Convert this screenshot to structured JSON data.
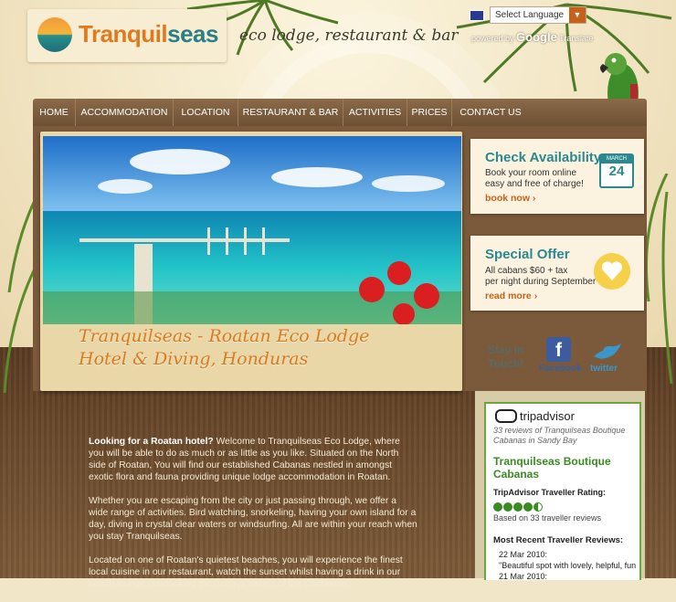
{
  "header": {
    "logo_text_a": "Tranquil",
    "logo_text_b": "seas",
    "tagline": "eco lodge, restaurant & bar"
  },
  "translate": {
    "select_label": "Select Language",
    "powered_by": "powered by",
    "google": "Google",
    "translate": "Translate"
  },
  "nav": {
    "items": [
      {
        "label": "HOME"
      },
      {
        "label": "ACCOMMODATION"
      },
      {
        "label": "LOCATION"
      },
      {
        "label": "RESTAURANT & BAR"
      },
      {
        "label": "ACTIVITIES"
      },
      {
        "label": "PRICES"
      },
      {
        "label": "CONTACT US"
      }
    ]
  },
  "hero": {
    "caption_line1": "Tranquilseas - Roatan Eco Lodge",
    "caption_line2": "Hotel & Diving, Honduras"
  },
  "availability": {
    "title": "Check Availability",
    "text1": "Book your room online",
    "text2": "easy and free of charge!",
    "link": "book now ›",
    "calendar_month": "MARCH",
    "calendar_day": "24"
  },
  "offer": {
    "title": "Special Offer",
    "text1": "All cabans $60 + tax",
    "text2": "per night during September",
    "link": "read more ›"
  },
  "social": {
    "stay_line1": "Stay in",
    "stay_line2": "Touch!",
    "facebook_label": "Facebook",
    "twitter_label": "twitter"
  },
  "body": {
    "p1_bold": "Looking for a Roatan hotel?",
    "p1_rest": " Welcome to Tranquilseas Eco Lodge, where you will be able to do as much or as little as you like.  Situated on the North side of Roatan, You will find our established Cabanas nestled in amongst exotic flora and fauna providing unique lodge accommodation in Roatan.",
    "p2": "Whether you are escaping from the city or just passing through, we offer a wide range of activities.  Bird watching, snorkeling, having your own island for a day, diving in crystal clear waters or windsurfing.  All are within your reach when you stay Tranquilseas.",
    "p3": "Located on one of Roatan's quietest beaches, you will experience the finest local cuisine in our restaurant, watch the sunset whilst having a drink in our beach lounge overlooking the tranquil waters of the Caribbean."
  },
  "tripadvisor": {
    "logo": "tripadvisor",
    "subtitle": "33 reviews of Tranquilseas Boutique Cabanas in Sandy Bay",
    "name": "Tranquilseas Boutique Cabanas",
    "rating_label": "TripAdvisor Traveller Rating:",
    "rating_value": 4.5,
    "count_text": "Based on 33 traveller reviews",
    "recent_label": "Most Recent Traveller Reviews:",
    "reviews": [
      {
        "date": "22 Mar 2010:",
        "text": "\"Beautiful spot with lovely, helpful, fun"
      },
      {
        "date": "21 Mar 2010:",
        "text": ""
      }
    ]
  },
  "colors": {
    "accent_orange": "#d87a1e",
    "accent_teal": "#2b8890",
    "nav_brown": "#7a5a3a",
    "tripadvisor_green": "#3a8a22"
  }
}
